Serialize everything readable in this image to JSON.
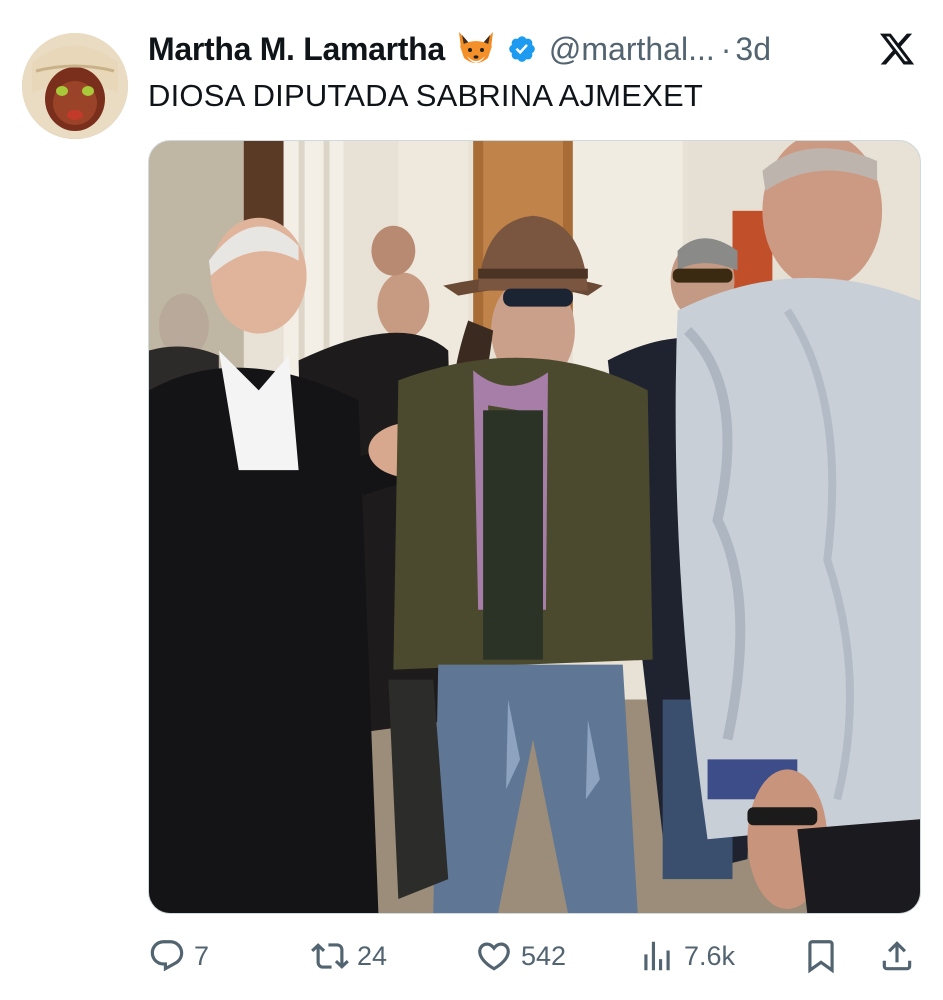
{
  "tweet": {
    "author": {
      "display_name": "Martha M. Lamartha",
      "handle": "@marthal...",
      "emoji_icon": "fox-emoji-icon",
      "verified_icon": "verified-badge-icon"
    },
    "separator": "·",
    "time": "3d",
    "platform_icon": "x-logo-icon",
    "text": "DIOSA DIPUTADA SABRINA AJMEXET",
    "media": {
      "type": "photo"
    },
    "actions": {
      "reply": {
        "icon": "reply-icon",
        "count": "7"
      },
      "retweet": {
        "icon": "retweet-icon",
        "count": "24"
      },
      "like": {
        "icon": "heart-icon",
        "count": "542"
      },
      "views": {
        "icon": "views-chart-icon",
        "count": "7.6k"
      },
      "bookmark": {
        "icon": "bookmark-icon"
      },
      "share": {
        "icon": "share-icon"
      }
    }
  },
  "colors": {
    "text_primary": "#0f1419",
    "text_secondary": "#536471",
    "verified_blue": "#1d9bf0",
    "border": "#cfd9de"
  }
}
